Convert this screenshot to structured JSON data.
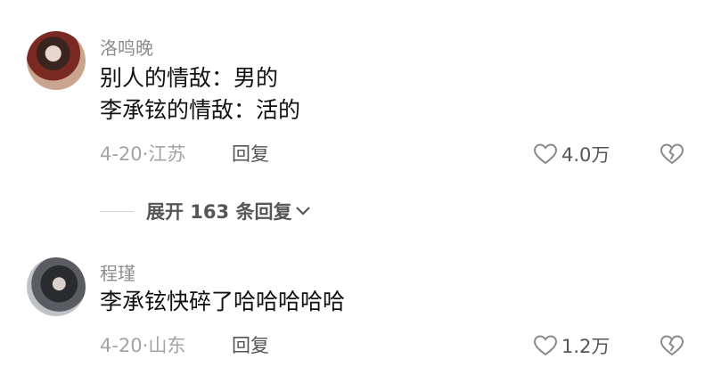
{
  "comments": [
    {
      "username": "洛鸣晚",
      "lines": [
        "别人的情敌：男的",
        "李承铉的情敌：活的"
      ],
      "date_location": "4-20·江苏",
      "reply_label": "回复",
      "likes": "4.0万"
    },
    {
      "username": "程瑾",
      "lines": [
        "李承铉快碎了哈哈哈哈哈"
      ],
      "date_location": "4-20·山东",
      "reply_label": "回复",
      "likes": "1.2万"
    }
  ],
  "expand_replies": {
    "label": "展开 163 条回复"
  },
  "icons": {
    "like": "heart-outline-icon",
    "dislike": "broken-heart-icon",
    "expand": "chevron-down-icon"
  }
}
